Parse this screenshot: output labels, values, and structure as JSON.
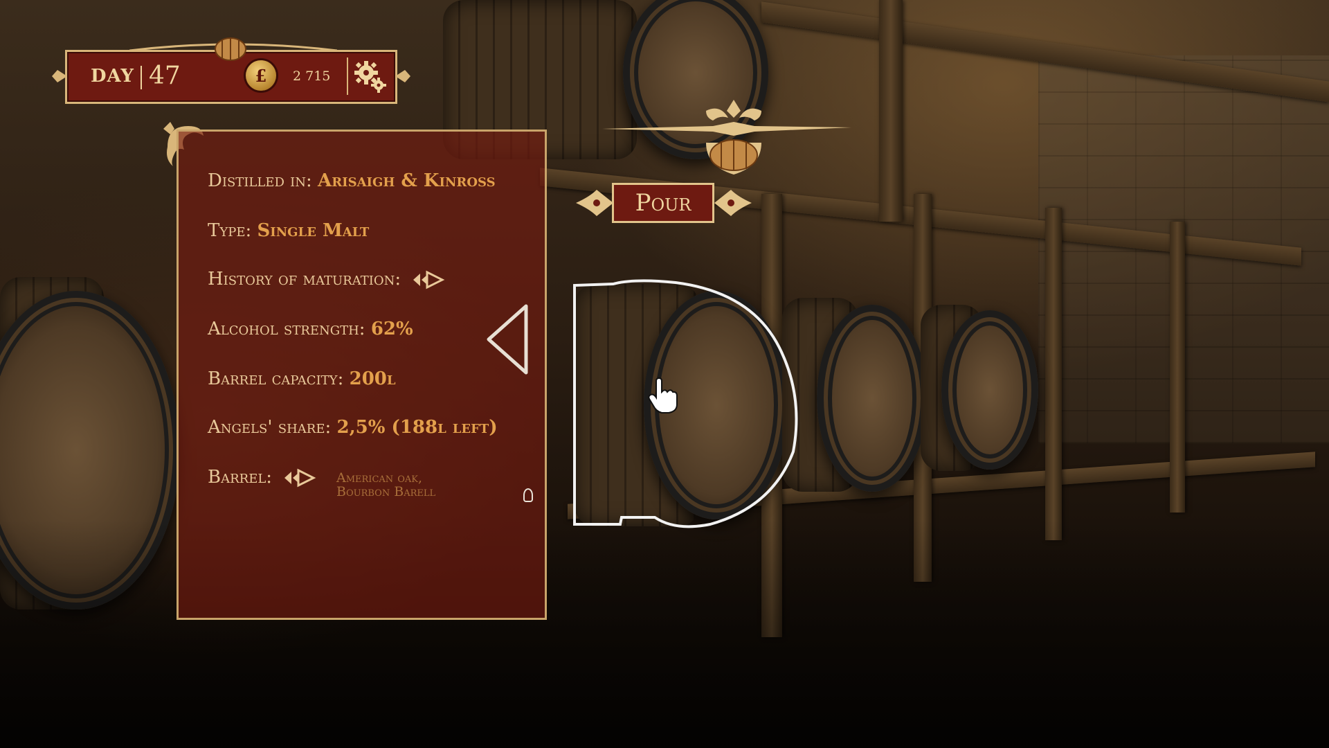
{
  "hud": {
    "day_label": "DAY",
    "day_number": "47",
    "currency_symbol": "£",
    "money": "2 715"
  },
  "info_panel": {
    "distilled_in_label": "Distilled in:",
    "distilled_in_value": "Arisaigh & Kinross",
    "type_label": "Type:",
    "type_value": "Single Malt",
    "history_label": "History of maturation:",
    "alcohol_label": "Alcohol strength:",
    "alcohol_value": "62%",
    "capacity_label": "Barrel capacity:",
    "capacity_value": "200l",
    "angels_label": "Angels' share:",
    "angels_value": "2,5% (188l left)",
    "barrel_label": "Barrel:",
    "barrel_type_line1": "American oak,",
    "barrel_type_line2": "Bourbon Barell"
  },
  "actions": {
    "pour_label": "Pour"
  },
  "colors": {
    "panel_red": "#6e1a11",
    "gold": "#d9b67a",
    "value_orange": "#e3a04c"
  }
}
